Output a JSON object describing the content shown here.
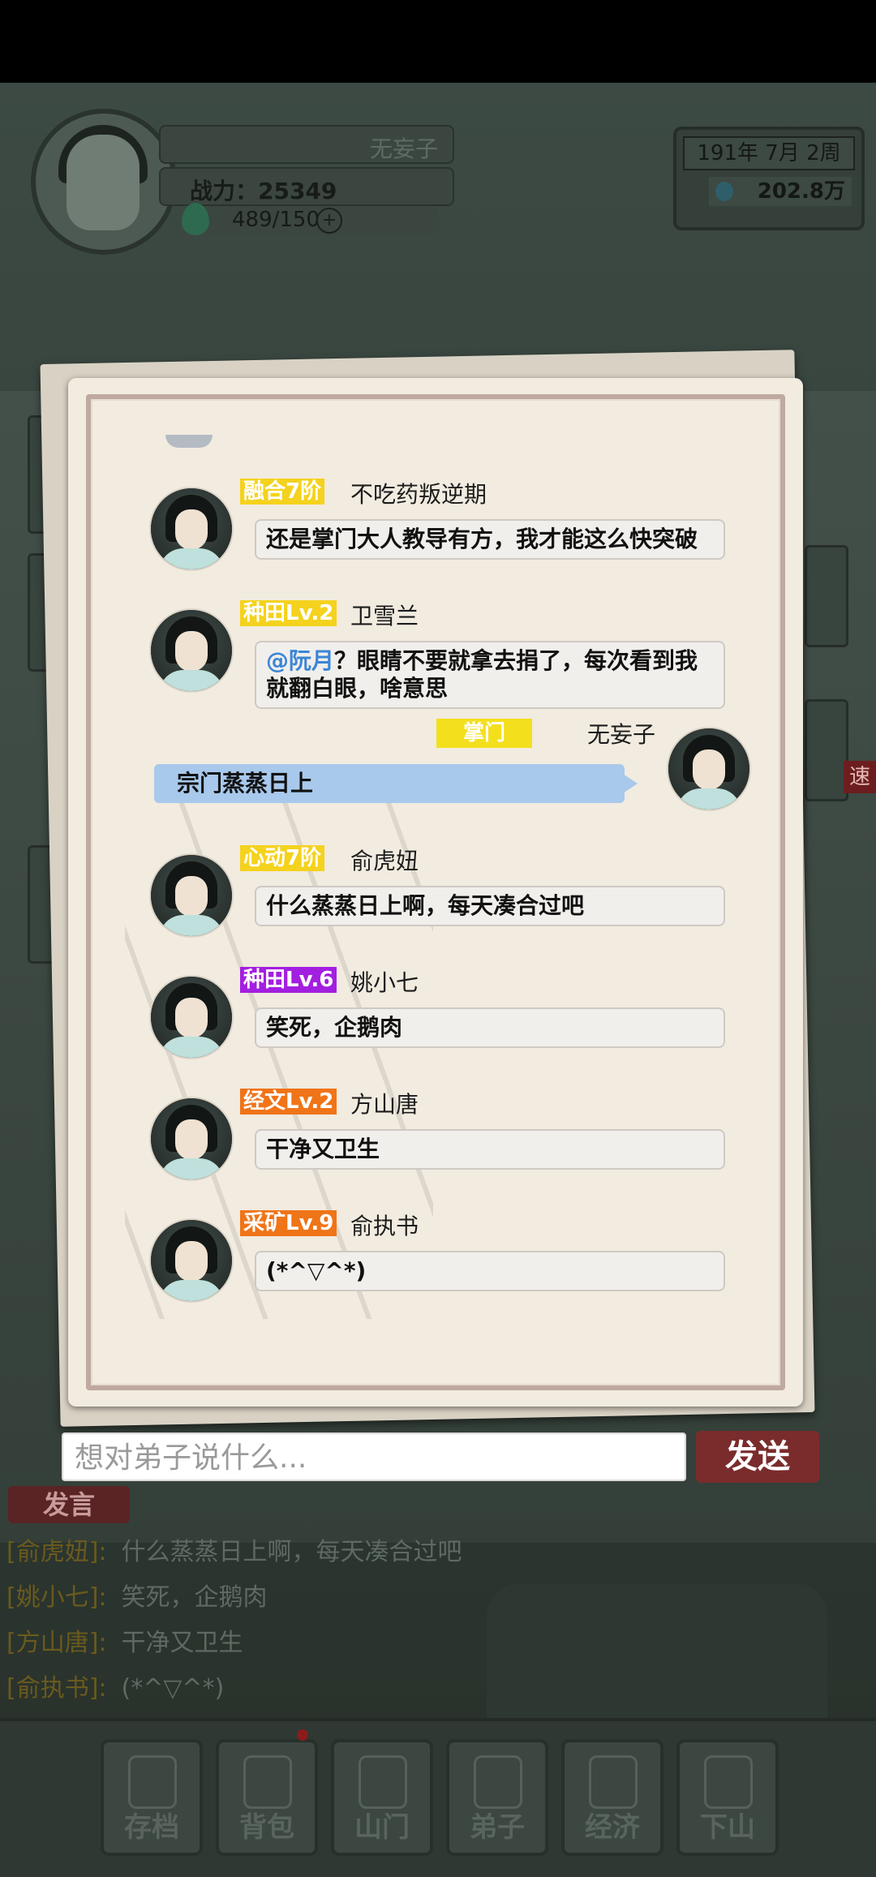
{
  "player": {
    "name": "无妄子",
    "power": "战力：25349",
    "stamina": "489/150",
    "plus": "+"
  },
  "calendar": {
    "date": "191年  7月  2周",
    "gold": "202.8万"
  },
  "side": {
    "speed": "速"
  },
  "chat": {
    "messages": [
      {
        "badge": "融合7阶",
        "badge_color": "#f4d21d",
        "name": "不吃药叛逆期",
        "text": "还是掌门大人教导有方，我才能这么快突破"
      },
      {
        "badge": "种田Lv.2",
        "badge_color": "#f4d21d",
        "name": "卫雪兰",
        "mention": "@阮月",
        "text": "？眼睛不要就拿去捐了，每次看到我就翻白眼，啥意思"
      },
      {
        "badge": "心动7阶",
        "badge_color": "#f4d21d",
        "name": "俞虎妞",
        "text": "什么蒸蒸日上啊，每天凑合过吧"
      },
      {
        "badge": "种田Lv.6",
        "badge_color": "#a31fe0",
        "name": "姚小七",
        "text": "笑死，企鹅肉"
      },
      {
        "badge": "经文Lv.2",
        "badge_color": "#f07418",
        "name": "方山唐",
        "text": "干净又卫生"
      },
      {
        "badge": "采矿Lv.9",
        "badge_color": "#f07418",
        "name": "俞执书",
        "text": "(*^▽^*)"
      }
    ],
    "self": {
      "badge": "掌门",
      "name": "无妄子",
      "text": "宗门蒸蒸日上"
    }
  },
  "input": {
    "placeholder": "想对弟子说什么...",
    "send_label": "发送"
  },
  "log": {
    "tab": "发言",
    "lines": [
      {
        "who": "[俞虎妞]:",
        "text": "什么蒸蒸日上啊，每天凑合过吧"
      },
      {
        "who": "[姚小七]:",
        "text": "笑死，企鹅肉"
      },
      {
        "who": "[方山唐]:",
        "text": "干净又卫生"
      },
      {
        "who": "[俞执书]:",
        "text": "(*^▽^*)"
      }
    ]
  },
  "nav": {
    "items": [
      "存档",
      "背包",
      "山门",
      "弟子",
      "经济",
      "下山"
    ]
  }
}
